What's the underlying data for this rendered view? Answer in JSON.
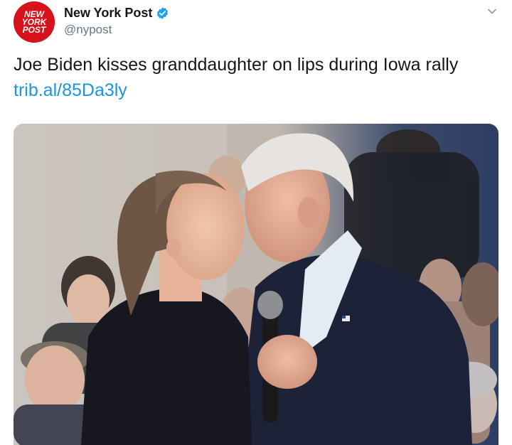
{
  "account": {
    "display_name": "New York Post",
    "handle": "@nypost",
    "avatar_text": [
      "NEW",
      "YORK",
      "POST"
    ],
    "verified": true,
    "brand_color": "#d8121b",
    "verified_color": "#1da1f2"
  },
  "tweet": {
    "text": "Joe Biden kisses granddaughter on lips during Iowa rally",
    "link": "trib.al/85Da3ly",
    "link_color": "#1b95e0"
  },
  "icons": {
    "verified": "verified-badge-icon",
    "caret": "chevron-down-icon"
  }
}
